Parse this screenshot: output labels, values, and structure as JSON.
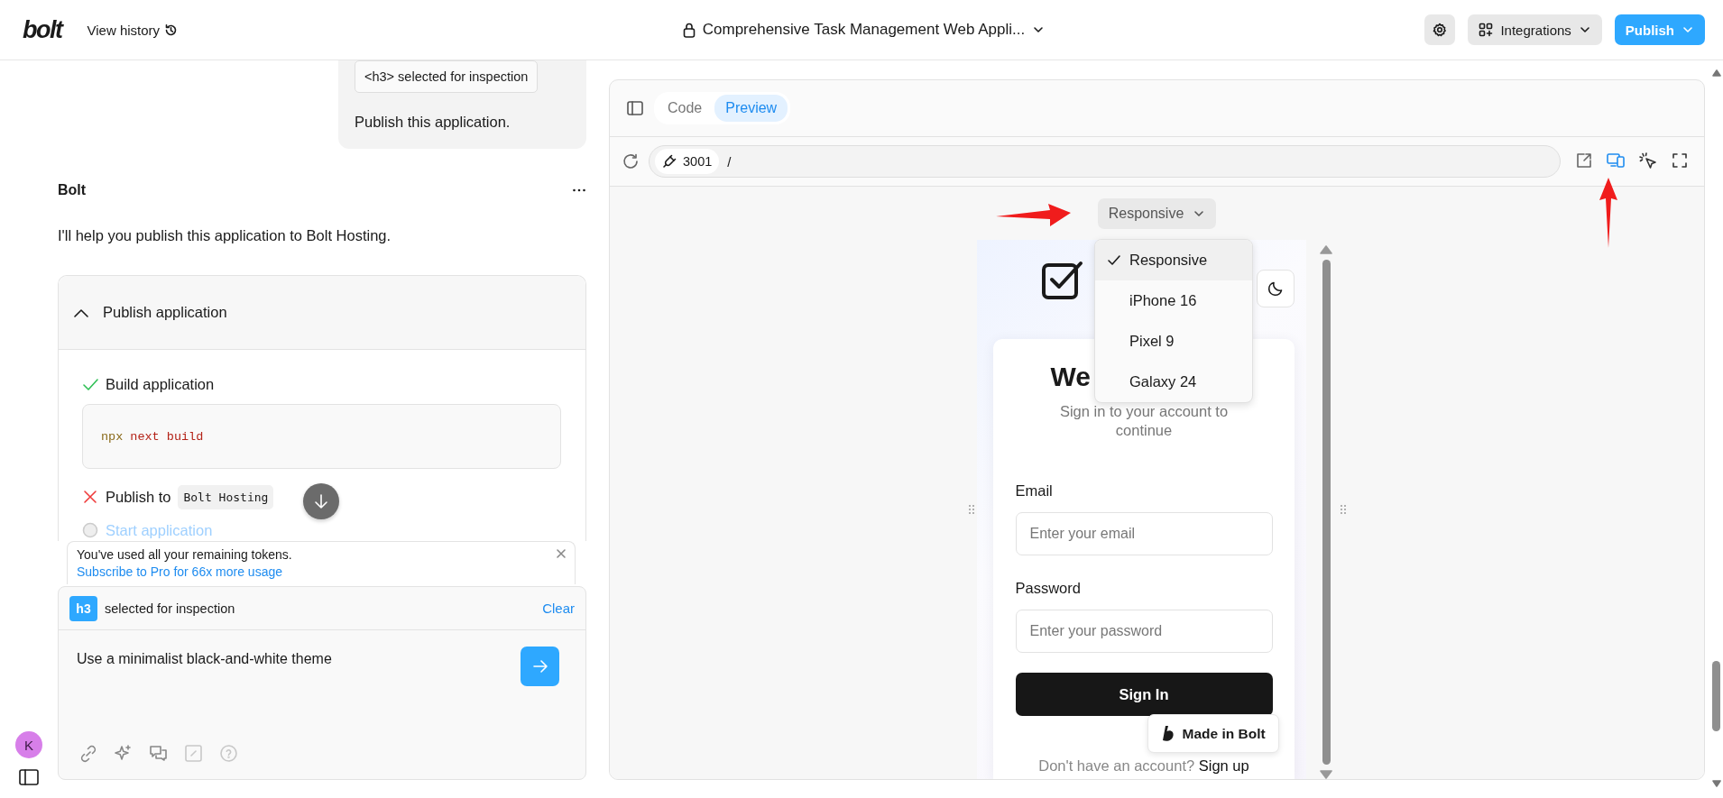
{
  "topbar": {
    "logo": "bolt",
    "history_label": "View history",
    "project_title": "Comprehensive Task Management Web Appli...",
    "integrations_label": "Integrations",
    "publish_label": "Publish"
  },
  "chat": {
    "user_message": {
      "inspection_chip": "<h3> selected for inspection",
      "text": "Publish this application."
    },
    "assistant": {
      "name": "Bolt",
      "text": "I'll help you publish this application to Bolt Hosting."
    },
    "action_card": {
      "title": "Publish application",
      "expanded": true,
      "steps": [
        {
          "kind": "done",
          "label": "Build application",
          "code": {
            "command": "npx",
            "arguments": "next build"
          }
        },
        {
          "kind": "failed",
          "label": "Publish to",
          "chip": "Bolt Hosting"
        },
        {
          "kind": "pending",
          "label": "Start application"
        }
      ]
    },
    "token_notice": {
      "text": "You've used all your remaining tokens.",
      "link": "Subscribe to Pro for 66x more usage"
    },
    "composer": {
      "tag": "h3",
      "inspection_label": "selected for inspection",
      "clear_label": "Clear",
      "value": "Use a minimalist black-and-white theme"
    },
    "user": {
      "initial": "K"
    }
  },
  "workbench": {
    "tabs": [
      {
        "label": "Code",
        "selected": false
      },
      {
        "label": "Preview",
        "selected": true
      }
    ],
    "port": "3001",
    "path": "/",
    "device_preview_active": true,
    "device_menu": {
      "label": "Responsive",
      "open": true,
      "options": [
        {
          "label": "Responsive",
          "selected": true
        },
        {
          "label": "iPhone 16",
          "selected": false
        },
        {
          "label": "Pixel 9",
          "selected": false
        },
        {
          "label": "Galaxy 24",
          "selected": false
        }
      ]
    },
    "preview": {
      "heading": "We",
      "subtitle": "Sign in to your account to continue",
      "email_label": "Email",
      "email_placeholder": "Enter your email",
      "password_label": "Password",
      "password_placeholder": "Enter your password",
      "sign_in": "Sign In",
      "signup_prompt": "Don't have an account?",
      "signup_link": "Sign up",
      "badge": "Made in Bolt"
    }
  }
}
